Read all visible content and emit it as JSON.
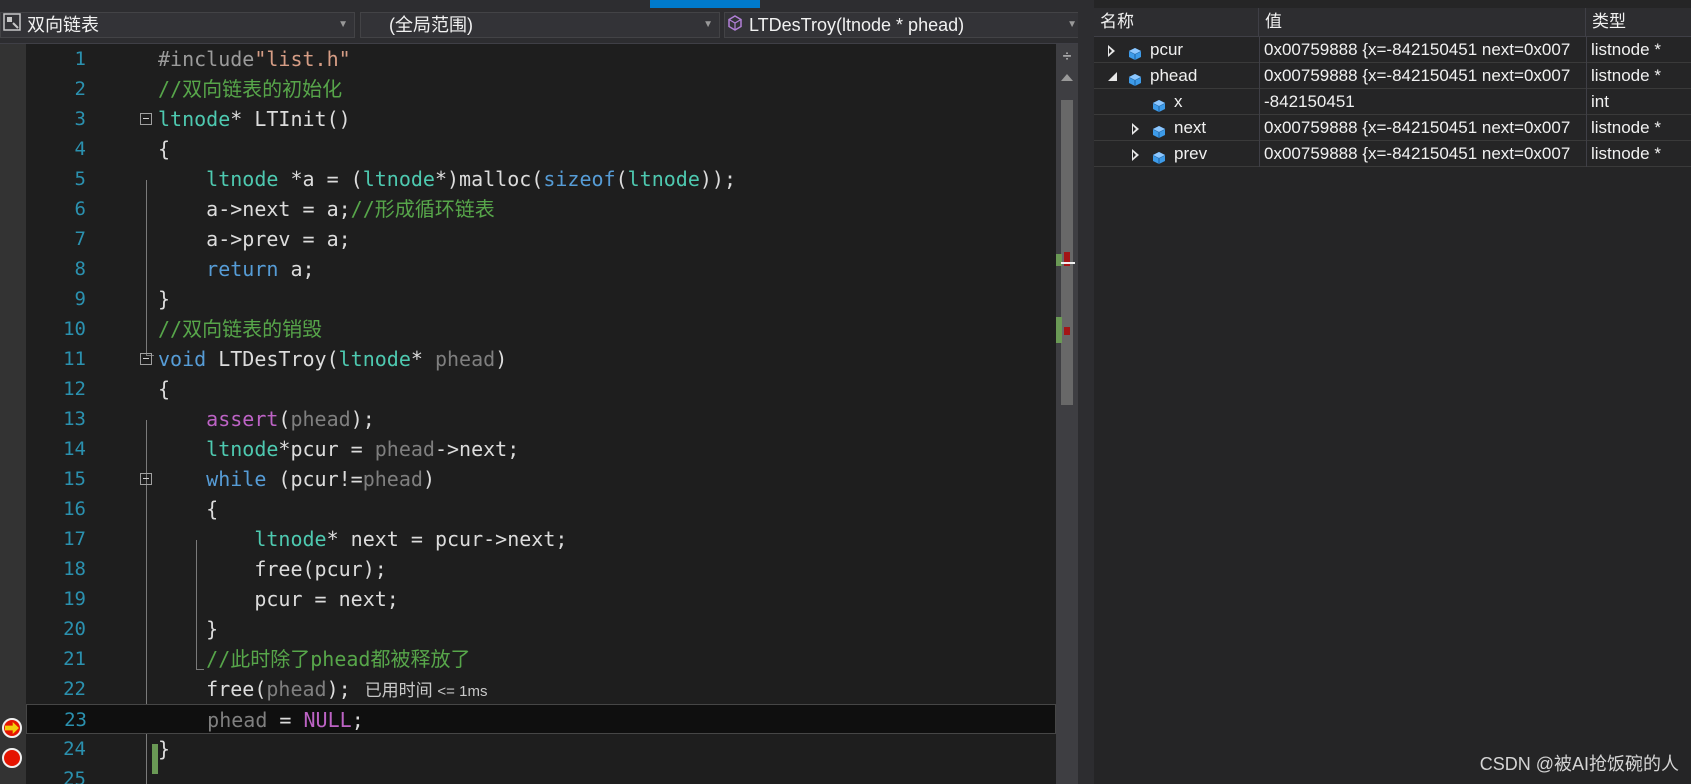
{
  "navbar": {
    "project": "双向链表",
    "scope": "(全局范围)",
    "function": "LTDesTroy(ltnode * phead)"
  },
  "lines": [
    {
      "n": "1",
      "tokens": [
        [
          "pp",
          "#include"
        ],
        [
          "st",
          "\"list.h\""
        ]
      ]
    },
    {
      "n": "2",
      "tokens": [
        [
          "cm",
          "//双向链表的初始化"
        ]
      ]
    },
    {
      "n": "3",
      "tokens": [
        [
          "ty",
          "ltnode"
        ],
        [
          "",
          "* LTInit()"
        ]
      ]
    },
    {
      "n": "4",
      "tokens": [
        [
          "",
          "{"
        ]
      ]
    },
    {
      "n": "5",
      "tokens": [
        [
          "",
          "    "
        ],
        [
          "ty",
          "ltnode"
        ],
        [
          "",
          " *a = ("
        ],
        [
          "ty",
          "ltnode"
        ],
        [
          "",
          "*)malloc("
        ],
        [
          "kw",
          "sizeof"
        ],
        [
          "",
          "("
        ],
        [
          "ty",
          "ltnode"
        ],
        [
          "",
          "));"
        ]
      ]
    },
    {
      "n": "6",
      "tokens": [
        [
          "",
          "    a->next = a;"
        ],
        [
          "cm",
          "//形成循环链表"
        ]
      ]
    },
    {
      "n": "7",
      "tokens": [
        [
          "",
          "    a->prev = a;"
        ]
      ]
    },
    {
      "n": "8",
      "tokens": [
        [
          "",
          "    "
        ],
        [
          "kw",
          "return"
        ],
        [
          "",
          " a;"
        ]
      ]
    },
    {
      "n": "9",
      "tokens": [
        [
          "",
          "}"
        ]
      ]
    },
    {
      "n": "10",
      "tokens": [
        [
          "cm",
          "//双向链表的销毁"
        ]
      ]
    },
    {
      "n": "11",
      "tokens": [
        [
          "kw",
          "void"
        ],
        [
          "",
          " LTDesTroy("
        ],
        [
          "ty",
          "ltnode"
        ],
        [
          "",
          "* "
        ],
        [
          "pm",
          "phead"
        ],
        [
          "",
          ")"
        ]
      ]
    },
    {
      "n": "12",
      "tokens": [
        [
          "",
          "{"
        ]
      ]
    },
    {
      "n": "13",
      "tokens": [
        [
          "",
          "    "
        ],
        [
          "mac",
          "assert"
        ],
        [
          "",
          "("
        ],
        [
          "pm",
          "phead"
        ],
        [
          "",
          ");"
        ]
      ]
    },
    {
      "n": "14",
      "tokens": [
        [
          "",
          "    "
        ],
        [
          "ty",
          "ltnode"
        ],
        [
          "",
          "*pcur = "
        ],
        [
          "pm",
          "phead"
        ],
        [
          "",
          "->next;"
        ]
      ]
    },
    {
      "n": "15",
      "tokens": [
        [
          "",
          "    "
        ],
        [
          "kw",
          "while"
        ],
        [
          "",
          " (pcur!="
        ],
        [
          "pm",
          "phead"
        ],
        [
          "",
          ")"
        ]
      ]
    },
    {
      "n": "16",
      "tokens": [
        [
          "",
          "    {"
        ]
      ]
    },
    {
      "n": "17",
      "tokens": [
        [
          "",
          "        "
        ],
        [
          "ty",
          "ltnode"
        ],
        [
          "",
          "* next = pcur->next;"
        ]
      ]
    },
    {
      "n": "18",
      "tokens": [
        [
          "",
          "        free(pcur);"
        ]
      ]
    },
    {
      "n": "19",
      "tokens": [
        [
          "",
          "        pcur = next;"
        ]
      ]
    },
    {
      "n": "20",
      "tokens": [
        [
          "",
          "    }"
        ]
      ]
    },
    {
      "n": "21",
      "tokens": [
        [
          "",
          "    "
        ],
        [
          "cm",
          "//此时除了phead都被释放了"
        ]
      ]
    },
    {
      "n": "22",
      "tokens": [
        [
          "",
          "    free("
        ],
        [
          "pm",
          "phead"
        ],
        [
          "",
          ");"
        ]
      ]
    },
    {
      "n": "23",
      "tokens": [
        [
          "",
          "    "
        ],
        [
          "pm",
          "phead"
        ],
        [
          "",
          " = "
        ],
        [
          "nl",
          "NULL"
        ],
        [
          "",
          ";"
        ]
      ]
    },
    {
      "n": "24",
      "tokens": [
        [
          "",
          "}"
        ]
      ]
    },
    {
      "n": "25",
      "tokens": []
    }
  ],
  "elapsed": {
    "label": "已用时间",
    "value": "<= 1ms"
  },
  "watch": {
    "headers": {
      "name": "名称",
      "value": "值",
      "type": "类型"
    },
    "rows": [
      {
        "name": "pcur",
        "value": "0x00759888 {x=-842150451 next=0x007",
        "type": "listnode *",
        "expander": "collapsed",
        "indent": 0
      },
      {
        "name": "phead",
        "value": "0x00759888 {x=-842150451 next=0x007",
        "type": "listnode *",
        "expander": "expanded",
        "indent": 0
      },
      {
        "name": "x",
        "value": "-842150451",
        "type": "int",
        "expander": "none",
        "indent": 1
      },
      {
        "name": "next",
        "value": "0x00759888 {x=-842150451 next=0x007",
        "type": "listnode *",
        "expander": "collapsed",
        "indent": 1
      },
      {
        "name": "prev",
        "value": "0x00759888 {x=-842150451 next=0x007",
        "type": "listnode *",
        "expander": "collapsed",
        "indent": 1
      }
    ]
  },
  "watermark": "CSDN @被AI抢饭碗的人",
  "colors": {
    "accent": "#007acc",
    "breakpoint": "#e51400",
    "arrow": "#f2cc0c",
    "cube": "#3d9be9"
  }
}
